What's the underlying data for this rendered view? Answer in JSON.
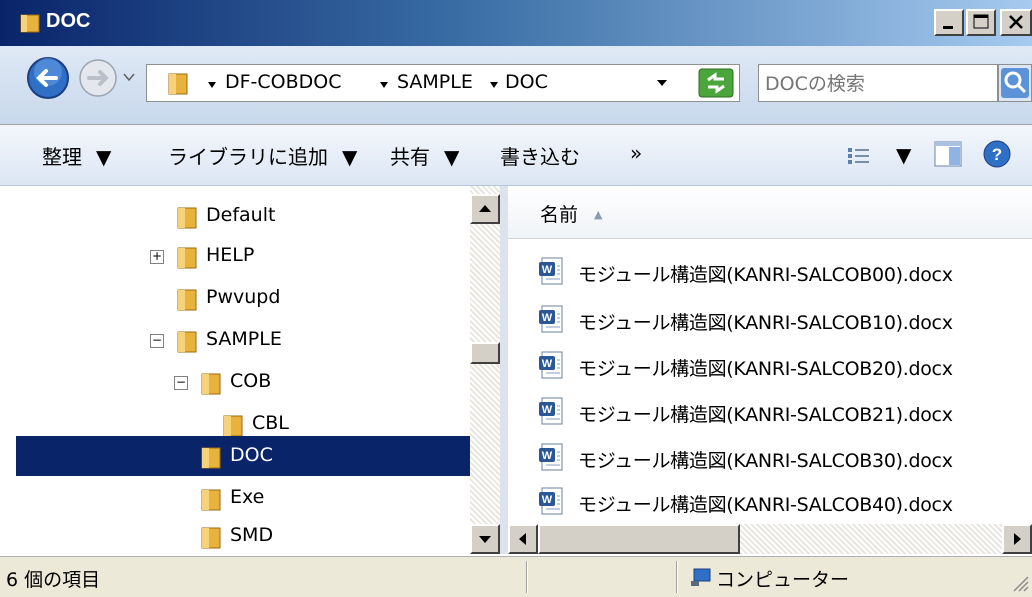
{
  "window": {
    "title": "DOC",
    "buttons": [
      "minimize",
      "maximize",
      "close"
    ]
  },
  "address": {
    "crumbs": [
      "DF-COBDOC",
      "SAMPLE",
      "DOC"
    ],
    "search_placeholder": "DOCの検索"
  },
  "toolbar": {
    "organize": "整理",
    "add_to_library": "ライブラリに追加",
    "share": "共有",
    "burn": "書き込む",
    "more": "»"
  },
  "tree": {
    "items": [
      {
        "label": "Default"
      },
      {
        "label": "HELP",
        "toggle": "+"
      },
      {
        "label": "Pwvupd"
      },
      {
        "label": "SAMPLE",
        "toggle": "−"
      },
      {
        "label": "COB",
        "toggle": "−"
      },
      {
        "label": "CBL"
      },
      {
        "label": "DOC",
        "selected": true
      },
      {
        "label": "Exe"
      },
      {
        "label": "SMD"
      }
    ]
  },
  "files": {
    "column_name": "名前",
    "sort_indicator": "▲",
    "items": [
      {
        "name": "モジュール構造図(KANRI-SALCOB00).docx"
      },
      {
        "name": "モジュール構造図(KANRI-SALCOB10).docx"
      },
      {
        "name": "モジュール構造図(KANRI-SALCOB20).docx"
      },
      {
        "name": "モジュール構造図(KANRI-SALCOB21).docx"
      },
      {
        "name": "モジュール構造図(KANRI-SALCOB30).docx"
      },
      {
        "name": "モジュール構造図(KANRI-SALCOB40).docx"
      }
    ]
  },
  "status": {
    "count": "6 個の項目",
    "zone": "コンピューター"
  },
  "colors": {
    "title_start": "#0a246a",
    "selection": "#0a246a",
    "folder": "#e8b33c"
  }
}
